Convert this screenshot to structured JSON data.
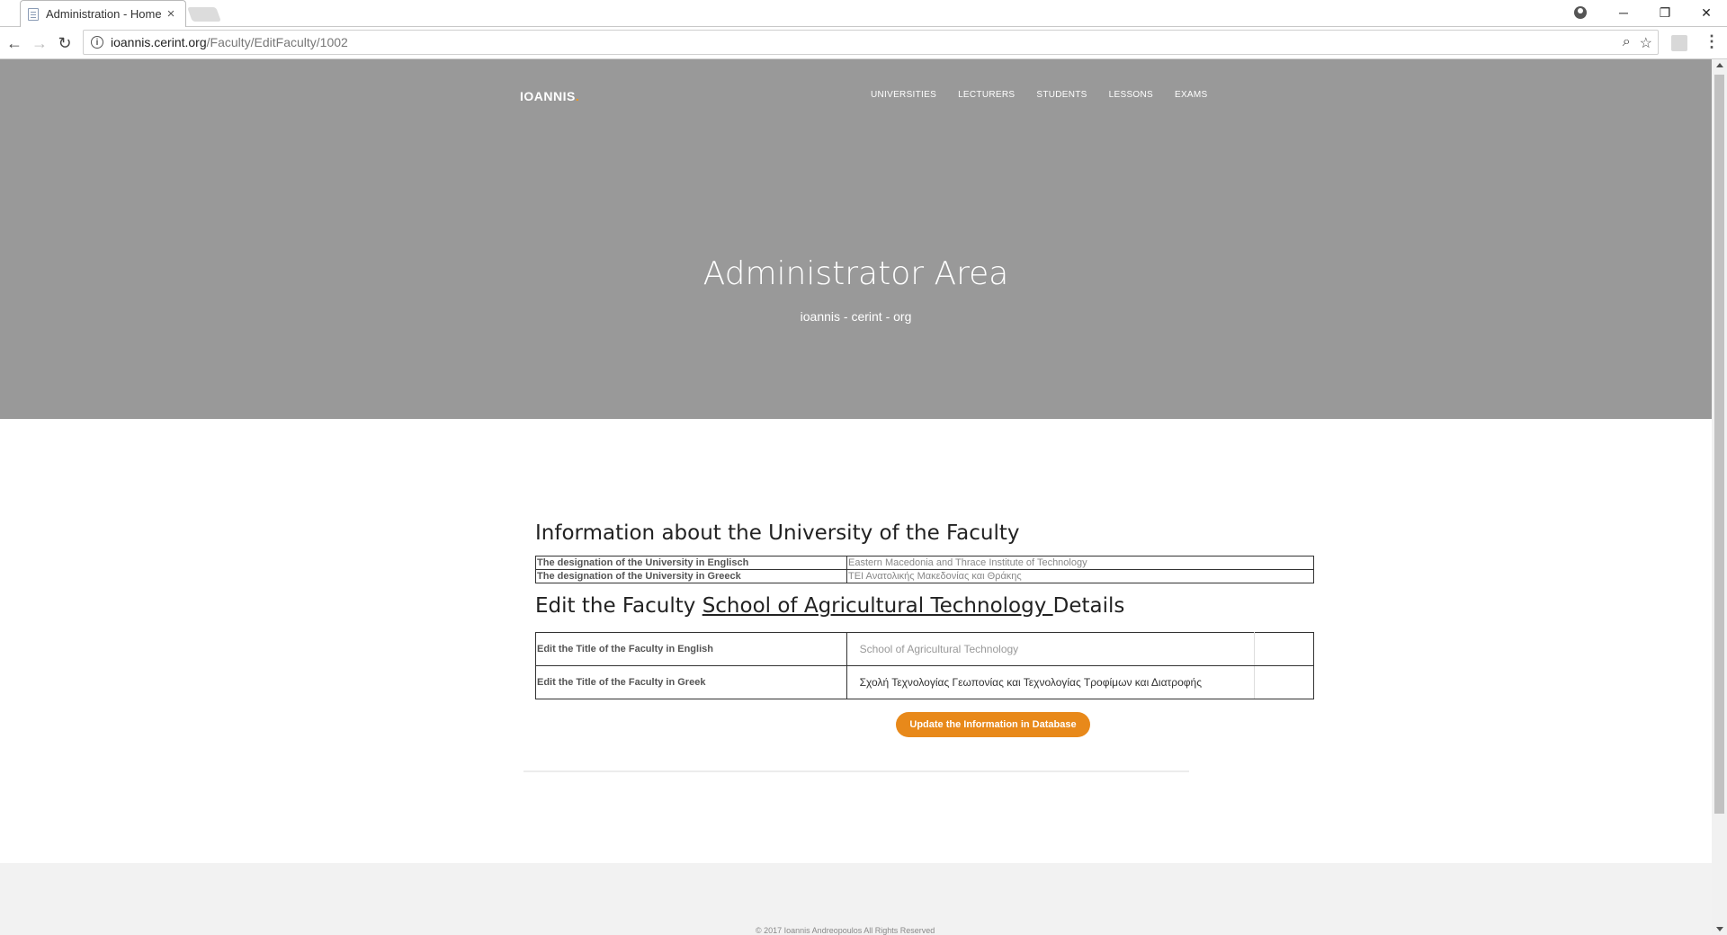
{
  "browser": {
    "tab_title": "Administration - Home -",
    "tab_close": "×",
    "url_host": "ioannis.cerint.org",
    "url_path": "/Faculty/EditFaculty/1002",
    "info_glyph": "i",
    "back_glyph": "←",
    "forward_glyph": "→",
    "reload_glyph": "↻",
    "zoom_glyph": "⌕",
    "star_glyph": "☆",
    "menu_glyph": "⋮",
    "minimize_glyph": "─",
    "restore_glyph": "❐",
    "close_glyph": "✕"
  },
  "header": {
    "brand": "IOANNIS",
    "brand_dot": ".",
    "nav": [
      "UNIVERSITIES",
      "LECTURERS",
      "STUDENTS",
      "LESSONS",
      "EXAMS"
    ],
    "title": "Administrator Area",
    "subtitle": "ioannis - cerint - org"
  },
  "university_section": {
    "heading": "Information about the University of the Faculty",
    "rows": [
      {
        "label": "The designation of the University in Englisch",
        "value": "Eastern Macedonia and Thrace Institute of Technology"
      },
      {
        "label": "The designation of the University in Greeck",
        "value": "ΤΕΙ Ανατολικής Μακεδονίας και Θράκης"
      }
    ]
  },
  "faculty_section": {
    "heading_prefix": "Edit the Faculty ",
    "faculty_name": "School of Agricultural Technology ",
    "heading_suffix": "Details",
    "english_label": "Edit the Title of the Faculty in English",
    "english_placeholder": "School of Agricultural Technology",
    "english_value": "",
    "greek_label": "Edit the Title of the Faculty in Greek",
    "greek_value": "Σχολή Τεχνολογίας Γεωπονίας και Τεχνολογίας Τροφίμων και Διατροφής",
    "submit_label": "Update the Information in Database"
  },
  "footer": {
    "text": "© 2017 Ioannis Andreopoulos All Rights Reserved"
  },
  "colors": {
    "hero_bg": "#999999",
    "accent": "#e8891a"
  }
}
